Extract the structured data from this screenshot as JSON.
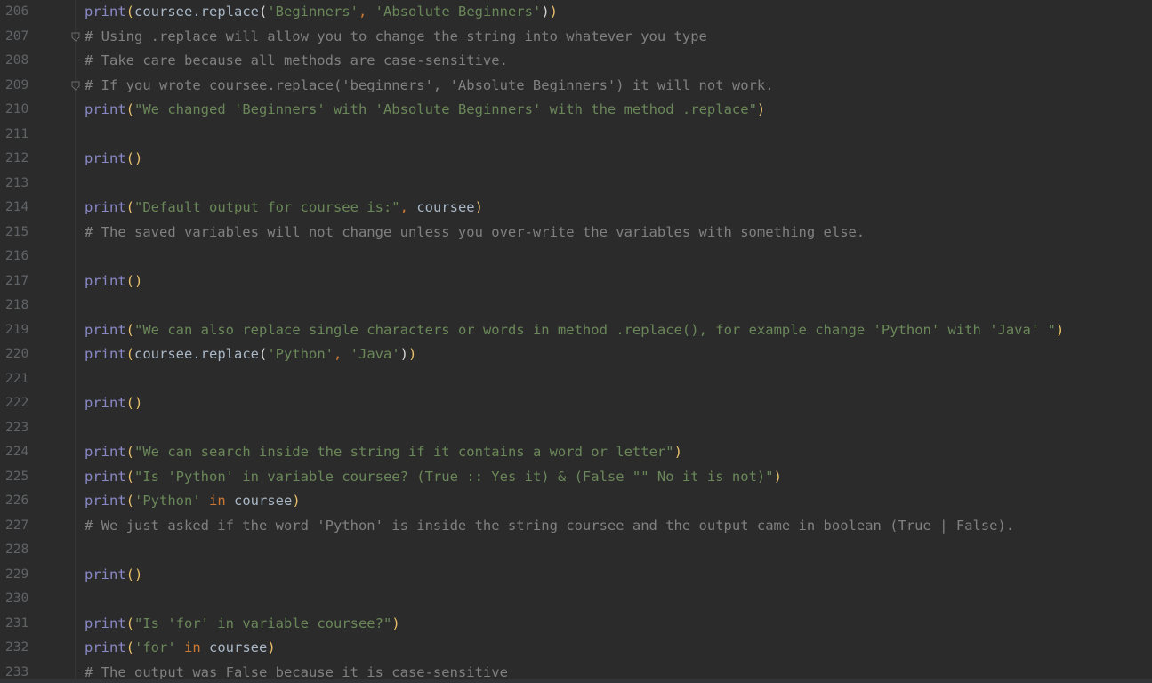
{
  "colors": {
    "background": "#2b2b2b",
    "line_number": "#606366",
    "builtin": "#8888c6",
    "identifier": "#a9b7c6",
    "string": "#6a8759",
    "comment": "#808080",
    "keyword": "#cc7832",
    "paren": "#e8bf6a"
  },
  "lines": [
    {
      "num": "206",
      "fold": false,
      "tokens": [
        {
          "t": "print",
          "k": "fn"
        },
        {
          "t": "(",
          "k": "paren1"
        },
        {
          "t": "coursee.replace",
          "k": "id"
        },
        {
          "t": "(",
          "k": "paren2"
        },
        {
          "t": "'Beginners'",
          "k": "str"
        },
        {
          "t": ", ",
          "k": "comma"
        },
        {
          "t": "'Absolute Beginners'",
          "k": "str"
        },
        {
          "t": ")",
          "k": "paren2"
        },
        {
          "t": ")",
          "k": "paren1"
        }
      ]
    },
    {
      "num": "207",
      "fold": true,
      "tokens": [
        {
          "t": "# Using .replace will allow you to change the string into whatever you type",
          "k": "com"
        }
      ]
    },
    {
      "num": "208",
      "fold": false,
      "tokens": [
        {
          "t": "# Take care because all methods are case-sensitive.",
          "k": "com"
        }
      ]
    },
    {
      "num": "209",
      "fold": true,
      "tokens": [
        {
          "t": "# If you wrote coursee.replace('beginners', 'Absolute Beginners') it will not work.",
          "k": "com"
        }
      ]
    },
    {
      "num": "210",
      "fold": false,
      "tokens": [
        {
          "t": "print",
          "k": "fn"
        },
        {
          "t": "(",
          "k": "paren1"
        },
        {
          "t": "\"We changed 'Beginners' with 'Absolute Beginners' with the method .replace\"",
          "k": "str"
        },
        {
          "t": ")",
          "k": "paren1"
        }
      ]
    },
    {
      "num": "211",
      "fold": false,
      "tokens": []
    },
    {
      "num": "212",
      "fold": false,
      "tokens": [
        {
          "t": "print",
          "k": "fn"
        },
        {
          "t": "()",
          "k": "paren1"
        }
      ]
    },
    {
      "num": "213",
      "fold": false,
      "tokens": []
    },
    {
      "num": "214",
      "fold": false,
      "tokens": [
        {
          "t": "print",
          "k": "fn"
        },
        {
          "t": "(",
          "k": "paren1"
        },
        {
          "t": "\"Default output for coursee is:\"",
          "k": "str"
        },
        {
          "t": ", ",
          "k": "comma"
        },
        {
          "t": "coursee",
          "k": "id"
        },
        {
          "t": ")",
          "k": "paren1"
        }
      ]
    },
    {
      "num": "215",
      "fold": false,
      "tokens": [
        {
          "t": "# The saved variables will not change unless you over-write the variables with something else.",
          "k": "com"
        }
      ]
    },
    {
      "num": "216",
      "fold": false,
      "tokens": []
    },
    {
      "num": "217",
      "fold": false,
      "tokens": [
        {
          "t": "print",
          "k": "fn"
        },
        {
          "t": "()",
          "k": "paren1"
        }
      ]
    },
    {
      "num": "218",
      "fold": false,
      "tokens": []
    },
    {
      "num": "219",
      "fold": false,
      "tokens": [
        {
          "t": "print",
          "k": "fn"
        },
        {
          "t": "(",
          "k": "paren1"
        },
        {
          "t": "\"We can also replace single characters or words in method .replace(), for example change 'Python' with 'Java' \"",
          "k": "str"
        },
        {
          "t": ")",
          "k": "paren1"
        }
      ]
    },
    {
      "num": "220",
      "fold": false,
      "tokens": [
        {
          "t": "print",
          "k": "fn"
        },
        {
          "t": "(",
          "k": "paren1"
        },
        {
          "t": "coursee.replace",
          "k": "id"
        },
        {
          "t": "(",
          "k": "paren2"
        },
        {
          "t": "'Python'",
          "k": "str"
        },
        {
          "t": ", ",
          "k": "comma"
        },
        {
          "t": "'Java'",
          "k": "str"
        },
        {
          "t": ")",
          "k": "paren2"
        },
        {
          "t": ")",
          "k": "paren1"
        }
      ]
    },
    {
      "num": "221",
      "fold": false,
      "tokens": []
    },
    {
      "num": "222",
      "fold": false,
      "tokens": [
        {
          "t": "print",
          "k": "fn"
        },
        {
          "t": "()",
          "k": "paren1"
        }
      ]
    },
    {
      "num": "223",
      "fold": false,
      "tokens": []
    },
    {
      "num": "224",
      "fold": false,
      "tokens": [
        {
          "t": "print",
          "k": "fn"
        },
        {
          "t": "(",
          "k": "paren1"
        },
        {
          "t": "\"We can search inside the string if it contains a word or letter\"",
          "k": "str"
        },
        {
          "t": ")",
          "k": "paren1"
        }
      ]
    },
    {
      "num": "225",
      "fold": false,
      "tokens": [
        {
          "t": "print",
          "k": "fn"
        },
        {
          "t": "(",
          "k": "paren1"
        },
        {
          "t": "\"Is 'Python' in variable coursee? (True :: Yes it) & (False \"\" No it is not)\"",
          "k": "str"
        },
        {
          "t": ")",
          "k": "paren1"
        }
      ]
    },
    {
      "num": "226",
      "fold": false,
      "tokens": [
        {
          "t": "print",
          "k": "fn"
        },
        {
          "t": "(",
          "k": "paren1"
        },
        {
          "t": "'Python'",
          "k": "str"
        },
        {
          "t": " in ",
          "k": "kw"
        },
        {
          "t": "coursee",
          "k": "id"
        },
        {
          "t": ")",
          "k": "paren1"
        }
      ]
    },
    {
      "num": "227",
      "fold": false,
      "tokens": [
        {
          "t": "# We just asked if the word 'Python' is inside the string coursee and the output came in boolean (True | False).",
          "k": "com"
        }
      ]
    },
    {
      "num": "228",
      "fold": false,
      "tokens": []
    },
    {
      "num": "229",
      "fold": false,
      "tokens": [
        {
          "t": "print",
          "k": "fn"
        },
        {
          "t": "()",
          "k": "paren1"
        }
      ]
    },
    {
      "num": "230",
      "fold": false,
      "tokens": []
    },
    {
      "num": "231",
      "fold": false,
      "tokens": [
        {
          "t": "print",
          "k": "fn"
        },
        {
          "t": "(",
          "k": "paren1"
        },
        {
          "t": "\"Is 'for' in variable coursee?\"",
          "k": "str"
        },
        {
          "t": ")",
          "k": "paren1"
        }
      ]
    },
    {
      "num": "232",
      "fold": false,
      "tokens": [
        {
          "t": "print",
          "k": "fn"
        },
        {
          "t": "(",
          "k": "paren1"
        },
        {
          "t": "'for'",
          "k": "str"
        },
        {
          "t": " in ",
          "k": "kw"
        },
        {
          "t": "coursee",
          "k": "id"
        },
        {
          "t": ")",
          "k": "paren1"
        }
      ]
    },
    {
      "num": "233",
      "fold": false,
      "tokens": [
        {
          "t": "# The output was False because it is case-sensitive",
          "k": "com"
        }
      ]
    }
  ]
}
